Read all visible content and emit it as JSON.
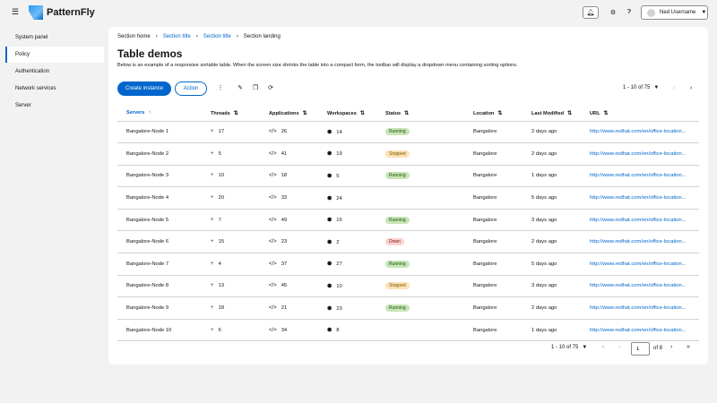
{
  "header": {
    "brand": "PatternFly",
    "user_name": "Ned Username"
  },
  "sidebar": {
    "items": [
      {
        "label": "System panel"
      },
      {
        "label": "Policy"
      },
      {
        "label": "Authentication"
      },
      {
        "label": "Network services"
      },
      {
        "label": "Server"
      }
    ]
  },
  "breadcrumb": [
    "Section home",
    "Section title",
    "Section title",
    "Section landing"
  ],
  "page": {
    "title": "Table demos",
    "description": "Below is an example of a responsive sortable table. When the screen size shrinks the table into a compact form, the toolbar will display a dropdown menu containing sorting options."
  },
  "toolbar": {
    "create_label": "Create instance",
    "action_label": "Action",
    "pagination": "1 - 10 of 75"
  },
  "table": {
    "columns": [
      "Servers",
      "Threads",
      "Applications",
      "Workspaces",
      "Status",
      "Location",
      "Last Modified",
      "URL"
    ],
    "rows": [
      {
        "server": "Bangalore-Node 1",
        "threads": "17",
        "apps": "26",
        "workspaces": "14",
        "status": "Running",
        "location": "Bangalore",
        "modified": "2 days ago",
        "url": "http://www.redhat.com/en/office-location..."
      },
      {
        "server": "Bangalore-Node 2",
        "threads": "5",
        "apps": "41",
        "workspaces": "19",
        "status": "Stopped",
        "location": "Bangalore",
        "modified": "2 days ago",
        "url": "http://www.redhat.com/en/office-location..."
      },
      {
        "server": "Bangalore-Node 3",
        "threads": "10",
        "apps": "18",
        "workspaces": "5",
        "status": "Running",
        "location": "Bangalore",
        "modified": "1 days ago",
        "url": "http://www.redhat.com/en/office-location..."
      },
      {
        "server": "Bangalore-Node 4",
        "threads": "20",
        "apps": "33",
        "workspaces": "24",
        "status": "",
        "location": "Bangalore",
        "modified": "5 days ago",
        "url": "http://www.redhat.com/en/office-location..."
      },
      {
        "server": "Bangalore-Node 5",
        "threads": "7",
        "apps": "49",
        "workspaces": "16",
        "status": "Running",
        "location": "Bangalore",
        "modified": "3 days ago",
        "url": "http://www.redhat.com/en/office-location..."
      },
      {
        "server": "Bangalore-Node 6",
        "threads": "15",
        "apps": "23",
        "workspaces": "2",
        "status": "Down",
        "location": "Bangalore",
        "modified": "2 days ago",
        "url": "http://www.redhat.com/en/office-location..."
      },
      {
        "server": "Bangalore-Node 7",
        "threads": "4",
        "apps": "37",
        "workspaces": "27",
        "status": "Running",
        "location": "Bangalore",
        "modified": "5 days ago",
        "url": "http://www.redhat.com/en/office-location..."
      },
      {
        "server": "Bangalore-Node 8",
        "threads": "13",
        "apps": "45",
        "workspaces": "10",
        "status": "Stopped",
        "location": "Bangalore",
        "modified": "3 days ago",
        "url": "http://www.redhat.com/en/office-location..."
      },
      {
        "server": "Bangalore-Node 9",
        "threads": "18",
        "apps": "21",
        "workspaces": "23",
        "status": "Running",
        "location": "Bangalore",
        "modified": "2 days ago",
        "url": "http://www.redhat.com/en/office-location..."
      },
      {
        "server": "Bangalore-Node 10",
        "threads": "6",
        "apps": "34",
        "workspaces": "8",
        "status": "",
        "location": "Bangalore",
        "modified": "1 days ago",
        "url": "http://www.redhat.com/en/office-location..."
      }
    ]
  },
  "pagination": {
    "summary": "1 - 10 of 75",
    "current_page": "1",
    "of_pages": "of 8"
  }
}
